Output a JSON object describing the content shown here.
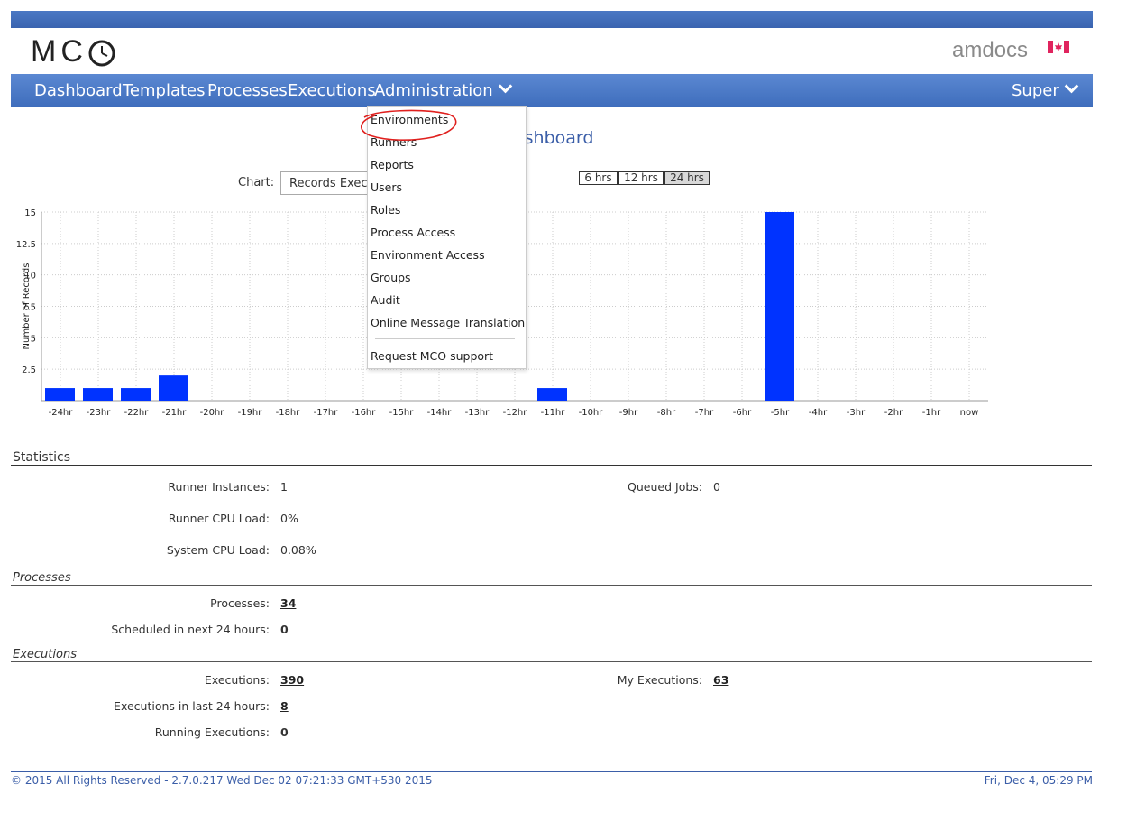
{
  "header": {
    "logo": "MCO",
    "brand": "amdocs"
  },
  "nav": {
    "items": [
      "Dashboard",
      "Templates",
      "Processes",
      "Executions",
      "Administration"
    ],
    "user": "Super"
  },
  "admin_menu": {
    "items": [
      "Environments",
      "Runners",
      "Reports",
      "Users",
      "Roles",
      "Process Access",
      "Environment Access",
      "Groups",
      "Audit",
      "Online Message Translation"
    ],
    "support": "Request MCO support",
    "highlighted": "Environments"
  },
  "dashboard": {
    "title_visible": "ashboard",
    "chart_label": "Chart:",
    "chart_select": "Records Execut",
    "ranges": [
      "6 hrs",
      "12 hrs",
      "24 hrs"
    ],
    "active_range": "24 hrs"
  },
  "chart_data": {
    "type": "bar",
    "ylabel": "Number of Records",
    "xlabel": "",
    "ylim": [
      0,
      15
    ],
    "yticks": [
      "2.5",
      "5",
      "7.5",
      "10",
      "12.5",
      "15"
    ],
    "categories": [
      "-24hr",
      "-23hr",
      "-22hr",
      "-21hr",
      "-20hr",
      "-19hr",
      "-18hr",
      "-17hr",
      "-16hr",
      "-15hr",
      "-14hr",
      "-13hr",
      "-12hr",
      "-11hr",
      "-10hr",
      "-9hr",
      "-8hr",
      "-7hr",
      "-6hr",
      "-5hr",
      "-4hr",
      "-3hr",
      "-2hr",
      "-1hr",
      "now"
    ],
    "values": [
      1,
      1,
      1,
      2,
      0,
      0,
      0,
      0,
      0,
      0,
      0,
      0,
      0,
      1,
      0,
      0,
      0,
      0,
      0,
      15,
      0,
      0,
      0,
      0,
      0
    ],
    "bar_color": "#0033ff",
    "grid": true
  },
  "statistics": {
    "title": "Statistics",
    "runner_instances_label": "Runner Instances:",
    "runner_instances": "1",
    "queued_jobs_label": "Queued Jobs:",
    "queued_jobs": "0",
    "runner_cpu_label": "Runner CPU Load:",
    "runner_cpu": "0%",
    "system_cpu_label": "System CPU Load:",
    "system_cpu": "0.08%"
  },
  "processes": {
    "title": "Processes",
    "count_label": "Processes:",
    "count": "34",
    "scheduled_label": "Scheduled in next 24 hours:",
    "scheduled": "0"
  },
  "executions": {
    "title": "Executions",
    "count_label": "Executions:",
    "count": "390",
    "my_label": "My Executions:",
    "my": "63",
    "last24_label": "Executions in last 24 hours:",
    "last24": "8",
    "running_label": "Running Executions:",
    "running": "0"
  },
  "footer": {
    "left": "© 2015 All Rights Reserved - 2.7.0.217 Wed Dec 02 07:21:33 GMT+530 2015",
    "right": "Fri, Dec 4, 05:29 PM"
  },
  "colors": {
    "nav": "#4a7ac8",
    "accent": "#3b5ea8",
    "highlight_circle": "#e0201e"
  }
}
